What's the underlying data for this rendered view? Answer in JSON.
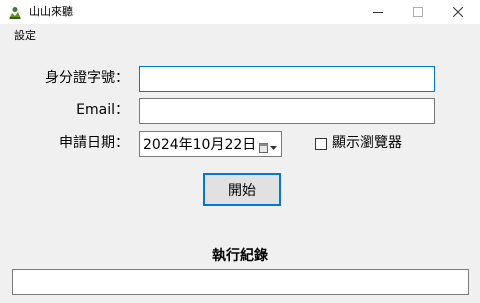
{
  "window": {
    "title": "山山來聽",
    "app_icon": "app-logo-icon",
    "controls": [
      "minimize-icon",
      "maximize-icon",
      "close-icon"
    ]
  },
  "menu": {
    "items": [
      {
        "label": "設定"
      }
    ]
  },
  "form": {
    "id_label": "身分證字號：",
    "id_value": "",
    "email_label": "Email：",
    "email_value": "",
    "date_label": "申請日期：",
    "date_value": "2024年10月22日",
    "date_icon": "calendar-dropdown-icon",
    "show_browser_label": "顯示瀏覽器",
    "show_browser_checked": false
  },
  "actions": {
    "start_label": "開始"
  },
  "log": {
    "title": "執行紀錄",
    "content": ""
  },
  "colors": {
    "background": "#f0f0f0",
    "focus_accent": "#0078d7",
    "button_face": "#e1e1e1",
    "border": "#7a7a7a"
  }
}
